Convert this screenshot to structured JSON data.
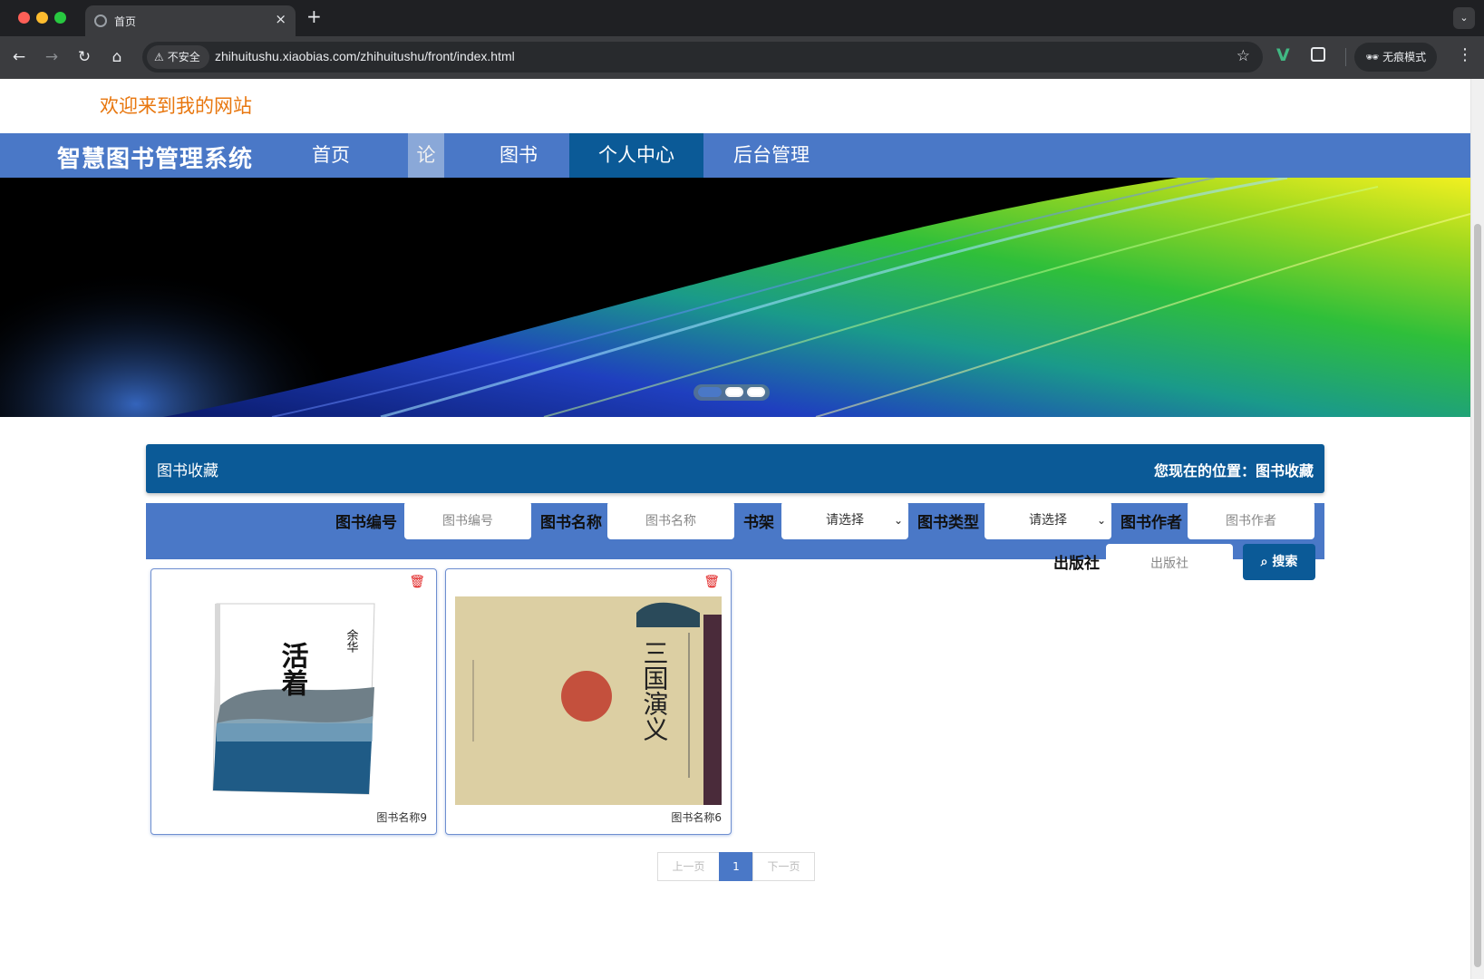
{
  "browser": {
    "tab_title": "首页",
    "url": "zhihuitushu.xiaobias.com/zhihuitushu/front/index.html",
    "security_label": "不安全",
    "incognito_label": "无痕模式"
  },
  "header": {
    "welcome": "欢迎来到我的网站",
    "brand": "智慧图书管理系统"
  },
  "nav": {
    "home": "首页",
    "forum": "论坛",
    "books": "图书",
    "personal": "个人中心",
    "admin": "后台管理"
  },
  "section": {
    "title": "图书收藏",
    "breadcrumb": "您现在的位置：图书收藏"
  },
  "filters": {
    "book_no_label": "图书编号",
    "book_no_placeholder": "图书编号",
    "book_name_label": "图书名称",
    "book_name_placeholder": "图书名称",
    "shelf_label": "书架",
    "shelf_value": "请选择",
    "type_label": "图书类型",
    "type_value": "请选择",
    "author_label": "图书作者",
    "author_placeholder": "图书作者",
    "publisher_label": "出版社",
    "publisher_placeholder": "出版社",
    "search_label": "搜索"
  },
  "books": [
    {
      "name": "图书名称9",
      "cover_title": "活着",
      "cover_author": "余华"
    },
    {
      "name": "图书名称6",
      "cover_title": "三国演义"
    }
  ],
  "pagination": {
    "prev": "上一页",
    "current": "1",
    "next": "下一页"
  },
  "colors": {
    "nav_blue": "#4a78c7",
    "dark_blue": "#0b5a97",
    "welcome_orange": "#e8770f",
    "delete_red": "#e02020"
  },
  "icons": {
    "delete": "trash-icon",
    "search": "search-icon"
  }
}
